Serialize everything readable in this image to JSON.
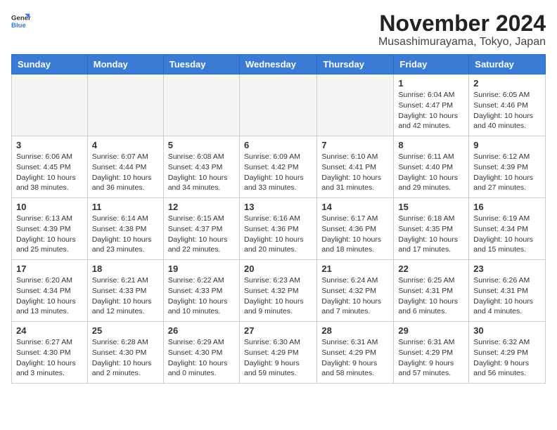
{
  "logo": {
    "line1": "General",
    "line2": "Blue"
  },
  "title": "November 2024",
  "location": "Musashimurayama, Tokyo, Japan",
  "days_of_week": [
    "Sunday",
    "Monday",
    "Tuesday",
    "Wednesday",
    "Thursday",
    "Friday",
    "Saturday"
  ],
  "weeks": [
    [
      {
        "day": "",
        "info": ""
      },
      {
        "day": "",
        "info": ""
      },
      {
        "day": "",
        "info": ""
      },
      {
        "day": "",
        "info": ""
      },
      {
        "day": "",
        "info": ""
      },
      {
        "day": "1",
        "info": "Sunrise: 6:04 AM\nSunset: 4:47 PM\nDaylight: 10 hours and 42 minutes."
      },
      {
        "day": "2",
        "info": "Sunrise: 6:05 AM\nSunset: 4:46 PM\nDaylight: 10 hours and 40 minutes."
      }
    ],
    [
      {
        "day": "3",
        "info": "Sunrise: 6:06 AM\nSunset: 4:45 PM\nDaylight: 10 hours and 38 minutes."
      },
      {
        "day": "4",
        "info": "Sunrise: 6:07 AM\nSunset: 4:44 PM\nDaylight: 10 hours and 36 minutes."
      },
      {
        "day": "5",
        "info": "Sunrise: 6:08 AM\nSunset: 4:43 PM\nDaylight: 10 hours and 34 minutes."
      },
      {
        "day": "6",
        "info": "Sunrise: 6:09 AM\nSunset: 4:42 PM\nDaylight: 10 hours and 33 minutes."
      },
      {
        "day": "7",
        "info": "Sunrise: 6:10 AM\nSunset: 4:41 PM\nDaylight: 10 hours and 31 minutes."
      },
      {
        "day": "8",
        "info": "Sunrise: 6:11 AM\nSunset: 4:40 PM\nDaylight: 10 hours and 29 minutes."
      },
      {
        "day": "9",
        "info": "Sunrise: 6:12 AM\nSunset: 4:39 PM\nDaylight: 10 hours and 27 minutes."
      }
    ],
    [
      {
        "day": "10",
        "info": "Sunrise: 6:13 AM\nSunset: 4:39 PM\nDaylight: 10 hours and 25 minutes."
      },
      {
        "day": "11",
        "info": "Sunrise: 6:14 AM\nSunset: 4:38 PM\nDaylight: 10 hours and 23 minutes."
      },
      {
        "day": "12",
        "info": "Sunrise: 6:15 AM\nSunset: 4:37 PM\nDaylight: 10 hours and 22 minutes."
      },
      {
        "day": "13",
        "info": "Sunrise: 6:16 AM\nSunset: 4:36 PM\nDaylight: 10 hours and 20 minutes."
      },
      {
        "day": "14",
        "info": "Sunrise: 6:17 AM\nSunset: 4:36 PM\nDaylight: 10 hours and 18 minutes."
      },
      {
        "day": "15",
        "info": "Sunrise: 6:18 AM\nSunset: 4:35 PM\nDaylight: 10 hours and 17 minutes."
      },
      {
        "day": "16",
        "info": "Sunrise: 6:19 AM\nSunset: 4:34 PM\nDaylight: 10 hours and 15 minutes."
      }
    ],
    [
      {
        "day": "17",
        "info": "Sunrise: 6:20 AM\nSunset: 4:34 PM\nDaylight: 10 hours and 13 minutes."
      },
      {
        "day": "18",
        "info": "Sunrise: 6:21 AM\nSunset: 4:33 PM\nDaylight: 10 hours and 12 minutes."
      },
      {
        "day": "19",
        "info": "Sunrise: 6:22 AM\nSunset: 4:33 PM\nDaylight: 10 hours and 10 minutes."
      },
      {
        "day": "20",
        "info": "Sunrise: 6:23 AM\nSunset: 4:32 PM\nDaylight: 10 hours and 9 minutes."
      },
      {
        "day": "21",
        "info": "Sunrise: 6:24 AM\nSunset: 4:32 PM\nDaylight: 10 hours and 7 minutes."
      },
      {
        "day": "22",
        "info": "Sunrise: 6:25 AM\nSunset: 4:31 PM\nDaylight: 10 hours and 6 minutes."
      },
      {
        "day": "23",
        "info": "Sunrise: 6:26 AM\nSunset: 4:31 PM\nDaylight: 10 hours and 4 minutes."
      }
    ],
    [
      {
        "day": "24",
        "info": "Sunrise: 6:27 AM\nSunset: 4:30 PM\nDaylight: 10 hours and 3 minutes."
      },
      {
        "day": "25",
        "info": "Sunrise: 6:28 AM\nSunset: 4:30 PM\nDaylight: 10 hours and 2 minutes."
      },
      {
        "day": "26",
        "info": "Sunrise: 6:29 AM\nSunset: 4:30 PM\nDaylight: 10 hours and 0 minutes."
      },
      {
        "day": "27",
        "info": "Sunrise: 6:30 AM\nSunset: 4:29 PM\nDaylight: 9 hours and 59 minutes."
      },
      {
        "day": "28",
        "info": "Sunrise: 6:31 AM\nSunset: 4:29 PM\nDaylight: 9 hours and 58 minutes."
      },
      {
        "day": "29",
        "info": "Sunrise: 6:31 AM\nSunset: 4:29 PM\nDaylight: 9 hours and 57 minutes."
      },
      {
        "day": "30",
        "info": "Sunrise: 6:32 AM\nSunset: 4:29 PM\nDaylight: 9 hours and 56 minutes."
      }
    ]
  ],
  "colors": {
    "header_bg": "#3a7bd5",
    "header_text": "#ffffff",
    "cell_border": "#cccccc",
    "empty_bg": "#f5f5f5"
  }
}
